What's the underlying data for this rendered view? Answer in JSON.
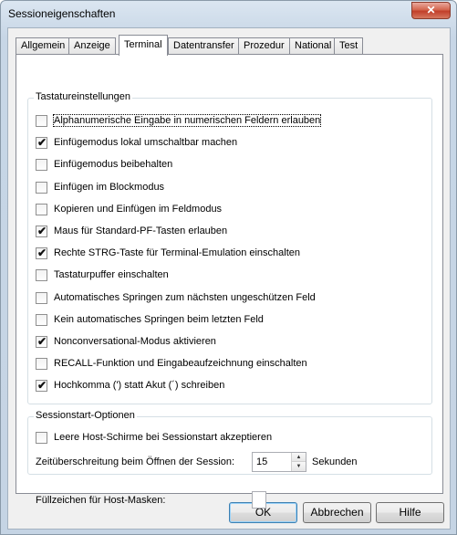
{
  "window": {
    "title": "Sessioneigenschaften",
    "close_glyph": "✕"
  },
  "tabs": [
    "Allgemein",
    "Anzeige",
    "Terminal",
    "Datentransfer",
    "Prozedur",
    "National",
    "Test"
  ],
  "active_tab": "Terminal",
  "keyboard_group": {
    "title": "Tastatureinstellungen",
    "options": [
      {
        "label": "Alphanumerische Eingabe in numerischen Feldern erlauben",
        "checked": false
      },
      {
        "label": "Einfügemodus lokal umschaltbar machen",
        "checked": true
      },
      {
        "label": "Einfügemodus beibehalten",
        "checked": false
      },
      {
        "label": "Einfügen im Blockmodus",
        "checked": false
      },
      {
        "label": "Kopieren und Einfügen im Feldmodus",
        "checked": false
      },
      {
        "label": "Maus für Standard-PF-Tasten erlauben",
        "checked": true
      },
      {
        "label": "Rechte STRG-Taste für Terminal-Emulation einschalten",
        "checked": true
      },
      {
        "label": "Tastaturpuffer einschalten",
        "checked": false
      },
      {
        "label": "Automatisches Springen zum nächsten ungeschützen Feld",
        "checked": false
      },
      {
        "label": "Kein automatisches Springen beim letzten Feld",
        "checked": false
      },
      {
        "label": "Nonconversational-Modus aktivieren",
        "checked": true
      },
      {
        "label": "RECALL-Funktion und Eingabeaufzeichnung einschalten",
        "checked": false
      },
      {
        "label": "Hochkomma (') statt Akut (´) schreiben",
        "checked": true
      }
    ]
  },
  "session_group": {
    "title": "Sessionstart-Optionen",
    "accept_empty": {
      "label": "Leere Host-Schirme bei Sessionstart akzeptieren",
      "checked": false
    },
    "timeout_label": "Zeitüberschreitung beim Öffnen der Session:",
    "timeout_value": "15",
    "timeout_unit": "Sekunden"
  },
  "fill_char": {
    "label": "Füllzeichen für Host-Masken:",
    "value": ""
  },
  "buttons": {
    "ok": "OK",
    "cancel": "Abbrechen",
    "help": "Hilfe"
  },
  "checkmark_glyph": "✔"
}
